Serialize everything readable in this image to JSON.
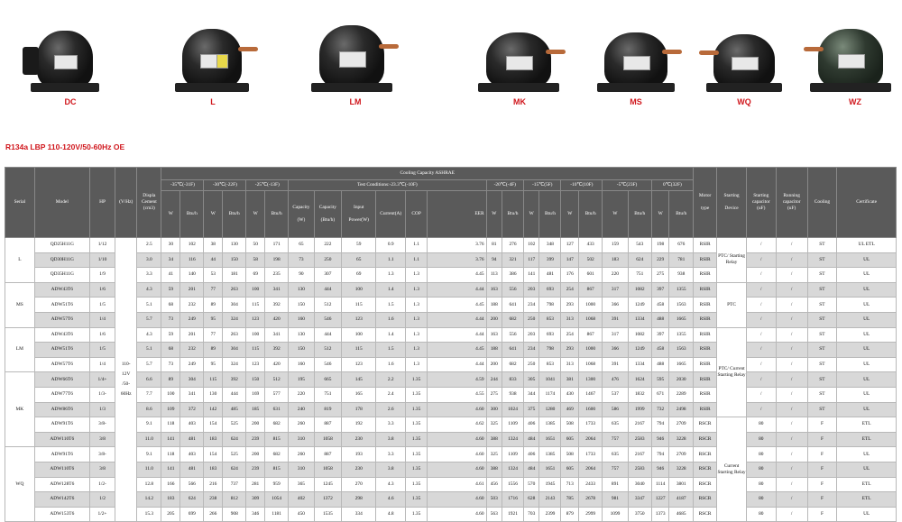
{
  "models_strip": [
    {
      "label": "DC",
      "relay": true
    },
    {
      "label": "L",
      "sticker": "yellow"
    },
    {
      "label": "LM"
    },
    {
      "label": "MK"
    },
    {
      "label": "MS"
    },
    {
      "label": "WQ"
    },
    {
      "label": "WZ",
      "green": true
    }
  ],
  "title": "R134a LBP 110-120V/50-60Hz OE",
  "header": {
    "serial": "Serial",
    "model": "Model",
    "hp": "HP",
    "vhz": "(V/Hz)",
    "disp": [
      "Displa",
      "Cement",
      "(cm3)"
    ],
    "capacity": "Cooling Capacity ASHRAE",
    "t35": "-35℃(-31F)",
    "t30": "-30℃(-22F)",
    "t25": "-25℃(-13F)",
    "test": "Test Conditions:-23.3℃(-10F)",
    "t20": "-20℃(-4F)",
    "t15": "-15℃(5F)",
    "t10": "-10℃(10F)",
    "t5": "-5℃(23F)",
    "t0": "0℃(32F)",
    "motor": [
      "Motor",
      "type"
    ],
    "starting": [
      "Starting",
      "Device"
    ],
    "startcap": [
      "Starting",
      "capacitor",
      "(uF)"
    ],
    "runcap": [
      "Running",
      "capacitor",
      "(uF)"
    ],
    "cooling": "Cooling",
    "cert": "Certificate",
    "w": "W",
    "btu": "Btu/h",
    "capw": [
      "Capacity",
      "(W)"
    ],
    "capbtu": [
      "Capacity",
      "(Btu/h)"
    ],
    "input": [
      "Input",
      "Power(W)"
    ],
    "current": "Current(A)",
    "cop": "COP",
    "eer": "EER"
  },
  "voltage": [
    "110-",
    "12V",
    "/50-",
    "60Hz"
  ],
  "rows": [
    {
      "serial": "L",
      "model": "QD25H11G",
      "hp": "1/12",
      "disp": "2.5",
      "a": [
        "30",
        "102",
        "38",
        "130",
        "50",
        "171"
      ],
      "test": [
        "65",
        "222",
        "59",
        "0.9",
        "1.1",
        "3.76"
      ],
      "b": [
        "81",
        "276",
        "102",
        "348",
        "127",
        "433",
        "159",
        "543",
        "198",
        "676"
      ],
      "motor": "RSIR",
      "sc": "/",
      "rc": "/",
      "cool": "ST",
      "cert": "UL ETL"
    },
    {
      "model": "QD30H11G",
      "hp": "1/10",
      "disp": "3.0",
      "a": [
        "34",
        "116",
        "44",
        "150",
        "58",
        "198"
      ],
      "test": [
        "73",
        "250",
        "65",
        "1.1",
        "1.1",
        "3.76"
      ],
      "b": [
        "94",
        "321",
        "117",
        "399",
        "147",
        "502",
        "183",
        "624",
        "229",
        "781"
      ],
      "motor": "RSIR",
      "sc": "/",
      "rc": "/",
      "cool": "ST",
      "cert": "UL"
    },
    {
      "model": "QD35H11G",
      "hp": "1/9",
      "disp": "3.3",
      "a": [
        "41",
        "140",
        "53",
        "181",
        "69",
        "235"
      ],
      "test": [
        "90",
        "307",
        "69",
        "1.3",
        "1.3",
        "4.45"
      ],
      "b": [
        "113",
        "386",
        "141",
        "481",
        "176",
        "601",
        "220",
        "751",
        "275",
        "938"
      ],
      "motor": "RSIR",
      "sc": "/",
      "rc": "/",
      "cool": "ST",
      "cert": "UL"
    },
    {
      "serial": "MS",
      "model": "ADW43T6",
      "hp": "1/6",
      "disp": "4.3",
      "a": [
        "59",
        "201",
        "77",
        "263",
        "100",
        "341"
      ],
      "test": [
        "130",
        "444",
        "100",
        "1.4",
        "1.3",
        "4.44"
      ],
      "b": [
        "163",
        "556",
        "203",
        "693",
        "254",
        "867",
        "317",
        "1082",
        "397",
        "1355"
      ],
      "motor": "RSIR",
      "sc": "/",
      "rc": "/",
      "cool": "ST",
      "cert": "UL"
    },
    {
      "model": "ADW51T6",
      "hp": "1/5",
      "disp": "5.1",
      "a": [
        "68",
        "232",
        "89",
        "304",
        "115",
        "392"
      ],
      "test": [
        "150",
        "512",
        "115",
        "1.5",
        "1.3",
        "4.45"
      ],
      "b": [
        "188",
        "641",
        "234",
        "798",
        "293",
        "1000",
        "366",
        "1249",
        "458",
        "1563"
      ],
      "motor": "RSIR",
      "sc": "/",
      "rc": "/",
      "cool": "ST",
      "cert": "UL"
    },
    {
      "model": "ADW57T6",
      "hp": "1/4",
      "disp": "5.7",
      "a": [
        "73",
        "249",
        "95",
        "324",
        "123",
        "420"
      ],
      "test": [
        "160",
        "546",
        "123",
        "1.6",
        "1.3",
        "4.44"
      ],
      "b": [
        "200",
        "682",
        "250",
        "853",
        "313",
        "1068",
        "391",
        "1334",
        "488",
        "1665"
      ],
      "motor": "RSIR",
      "sc": "/",
      "rc": "/",
      "cool": "ST",
      "cert": "UL"
    },
    {
      "serial": "LM",
      "model": "ADW43T6",
      "hp": "1/6",
      "disp": "4.3",
      "a": [
        "59",
        "201",
        "77",
        "263",
        "100",
        "341"
      ],
      "test": [
        "130",
        "444",
        "100",
        "1.4",
        "1.3",
        "4.44"
      ],
      "b": [
        "163",
        "556",
        "203",
        "693",
        "254",
        "867",
        "317",
        "1082",
        "397",
        "1355"
      ],
      "motor": "RSIR",
      "sc": "/",
      "rc": "/",
      "cool": "ST",
      "cert": "UL"
    },
    {
      "model": "ADW51T6",
      "hp": "1/5",
      "disp": "5.1",
      "a": [
        "68",
        "232",
        "89",
        "304",
        "115",
        "392"
      ],
      "test": [
        "150",
        "512",
        "115",
        "1.5",
        "1.3",
        "4.45"
      ],
      "b": [
        "188",
        "641",
        "234",
        "798",
        "293",
        "1000",
        "366",
        "1249",
        "458",
        "1563"
      ],
      "motor": "RSIR",
      "sc": "/",
      "rc": "/",
      "cool": "ST",
      "cert": "UL"
    },
    {
      "model": "ADW57T6",
      "hp": "1/4",
      "disp": "5.7",
      "a": [
        "73",
        "249",
        "95",
        "324",
        "123",
        "420"
      ],
      "test": [
        "160",
        "546",
        "123",
        "1.6",
        "1.3",
        "4.44"
      ],
      "b": [
        "200",
        "682",
        "250",
        "853",
        "313",
        "1068",
        "391",
        "1334",
        "488",
        "1665"
      ],
      "motor": "RSIR",
      "sc": "/",
      "rc": "/",
      "cool": "ST",
      "cert": "UL"
    },
    {
      "serial": "MK",
      "model": "ADW66T6",
      "hp": "1/4+",
      "disp": "6.6",
      "a": [
        "89",
        "304",
        "115",
        "392",
        "150",
        "512"
      ],
      "test": [
        "195",
        "665",
        "145",
        "2.2",
        "1.35",
        "4.59"
      ],
      "b": [
        "244",
        "833",
        "305",
        "1041",
        "381",
        "1300",
        "476",
        "1624",
        "595",
        "2030"
      ],
      "motor": "RSIR",
      "sc": "/",
      "rc": "/",
      "cool": "ST",
      "cert": "UL"
    },
    {
      "model": "ADW77T6",
      "hp": "1/3-",
      "disp": "7.7",
      "a": [
        "100",
        "341",
        "130",
        "444",
        "169",
        "577"
      ],
      "test": [
        "220",
        "751",
        "165",
        "2.4",
        "1.35",
        "4.55"
      ],
      "b": [
        "275",
        "938",
        "344",
        "1174",
        "430",
        "1467",
        "537",
        "1832",
        "671",
        "2289"
      ],
      "motor": "RSIR",
      "sc": "/",
      "rc": "/",
      "cool": "ST",
      "cert": "UL"
    },
    {
      "model": "ADW86T6",
      "hp": "1/3",
      "disp": "8.6",
      "a": [
        "109",
        "372",
        "142",
        "485",
        "185",
        "631"
      ],
      "test": [
        "240",
        "819",
        "178",
        "2.6",
        "1.35",
        "4.60"
      ],
      "b": [
        "300",
        "1024",
        "375",
        "1280",
        "469",
        "1600",
        "586",
        "1999",
        "732",
        "2498"
      ],
      "motor": "RSIR",
      "sc": "/",
      "rc": "/",
      "cool": "ST",
      "cert": "UL"
    },
    {
      "model": "ADW91T6",
      "hp": "3/8-",
      "disp": "9.1",
      "a": [
        "118",
        "403",
        "154",
        "525",
        "200",
        "682"
      ],
      "test": [
        "260",
        "887",
        "192",
        "3.3",
        "1.35",
        "4.62"
      ],
      "b": [
        "325",
        "1109",
        "406",
        "1385",
        "508",
        "1733",
        "635",
        "2167",
        "794",
        "2709"
      ],
      "motor": "RSCR",
      "sc": "80",
      "rc": "/",
      "cool": "F",
      "cert": "ETL"
    },
    {
      "model": "ADW110T6",
      "hp": "3/8",
      "disp": "11.0",
      "a": [
        "141",
        "481",
        "183",
        "624",
        "239",
        "815"
      ],
      "test": [
        "310",
        "1058",
        "230",
        "3.8",
        "1.35",
        "4.60"
      ],
      "b": [
        "388",
        "1324",
        "484",
        "1651",
        "605",
        "2064",
        "757",
        "2583",
        "946",
        "3228"
      ],
      "motor": "RSCR",
      "sc": "80",
      "rc": "/",
      "cool": "F",
      "cert": "ETL"
    },
    {
      "serial": "WQ",
      "model": "ADW91T6",
      "hp": "3/8-",
      "disp": "9.1",
      "a": [
        "118",
        "403",
        "154",
        "525",
        "200",
        "682"
      ],
      "test": [
        "260",
        "887",
        "193",
        "3.3",
        "1.35",
        "4.60"
      ],
      "b": [
        "325",
        "1109",
        "406",
        "1385",
        "508",
        "1733",
        "635",
        "2167",
        "794",
        "2709"
      ],
      "motor": "RSCR",
      "sc": "80",
      "rc": "/",
      "cool": "F",
      "cert": "UL"
    },
    {
      "model": "ADW110T6",
      "hp": "3/8",
      "disp": "11.0",
      "a": [
        "141",
        "481",
        "183",
        "624",
        "239",
        "815"
      ],
      "test": [
        "310",
        "1058",
        "230",
        "3.8",
        "1.35",
        "4.60"
      ],
      "b": [
        "388",
        "1324",
        "484",
        "1651",
        "605",
        "2064",
        "757",
        "2583",
        "946",
        "3228"
      ],
      "motor": "RSCR",
      "sc": "80",
      "rc": "/",
      "cool": "F",
      "cert": "UL"
    },
    {
      "model": "ADW128T6",
      "hp": "1/2-",
      "disp": "12.8",
      "a": [
        "166",
        "566",
        "216",
        "737",
        "281",
        "959"
      ],
      "test": [
        "365",
        "1245",
        "270",
        "4.3",
        "1.35",
        "4.61"
      ],
      "b": [
        "456",
        "1556",
        "570",
        "1945",
        "713",
        "2433",
        "891",
        "3040",
        "1114",
        "3801"
      ],
      "motor": "RSCR",
      "sc": "80",
      "rc": "/",
      "cool": "F",
      "cert": "ETL"
    },
    {
      "model": "ADW142T6",
      "hp": "1/2",
      "disp": "14.2",
      "a": [
        "183",
        "624",
        "238",
        "812",
        "309",
        "1054"
      ],
      "test": [
        "402",
        "1372",
        "298",
        "4.6",
        "1.35",
        "4.60"
      ],
      "b": [
        "503",
        "1716",
        "628",
        "2143",
        "785",
        "2678",
        "981",
        "3347",
        "1227",
        "4187"
      ],
      "motor": "RSCR",
      "sc": "80",
      "rc": "/",
      "cool": "F",
      "cert": "ETL"
    },
    {
      "model": "ADW153T6",
      "hp": "1/2+",
      "disp": "15.3",
      "a": [
        "205",
        "699",
        "266",
        "908",
        "346",
        "1181"
      ],
      "test": [
        "450",
        "1535",
        "334",
        "4.8",
        "1.35",
        "4.60"
      ],
      "b": [
        "563",
        "1921",
        "703",
        "2399",
        "879",
        "2999",
        "1099",
        "3750",
        "1373",
        "4685"
      ],
      "motor": "RSCR",
      "sc": "80",
      "rc": "/",
      "cool": "F",
      "cert": "UL"
    }
  ],
  "start_groups": [
    {
      "text": "PTC/ Starting Relay"
    },
    {
      "text": "PTC"
    },
    {
      "text": "PTC/ Current Starting Relay"
    },
    {
      "text": "Current Starting Relay"
    }
  ]
}
